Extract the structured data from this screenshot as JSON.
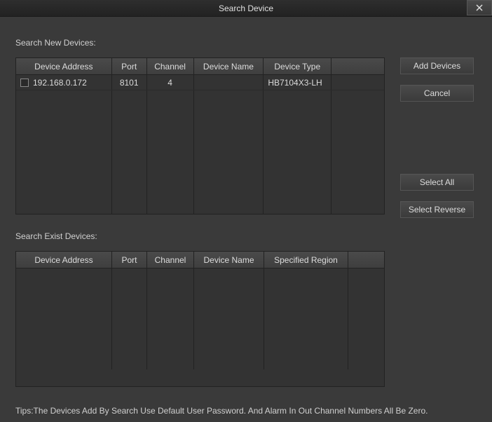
{
  "title": "Search Device",
  "labels": {
    "search_new": "Search New Devices:",
    "search_exist": "Search Exist Devices:"
  },
  "table_new": {
    "headers": {
      "address": "Device Address",
      "port": "Port",
      "channel": "Channel",
      "name": "Device Name",
      "type": "Device Type"
    },
    "rows": [
      {
        "checked": false,
        "address": "192.168.0.172",
        "port": "8101",
        "channel": "4",
        "name": "",
        "type": "HB7104X3-LH"
      }
    ]
  },
  "table_exist": {
    "headers": {
      "address": "Device Address",
      "port": "Port",
      "channel": "Channel",
      "name": "Device Name",
      "region": "Specified Region"
    },
    "rows": []
  },
  "buttons": {
    "add": "Add Devices",
    "cancel": "Cancel",
    "select_all": "Select All",
    "select_reverse": "Select Reverse"
  },
  "tips": "Tips:The Devices Add By Search Use Default User Password. And Alarm In Out Channel Numbers All Be Zero."
}
